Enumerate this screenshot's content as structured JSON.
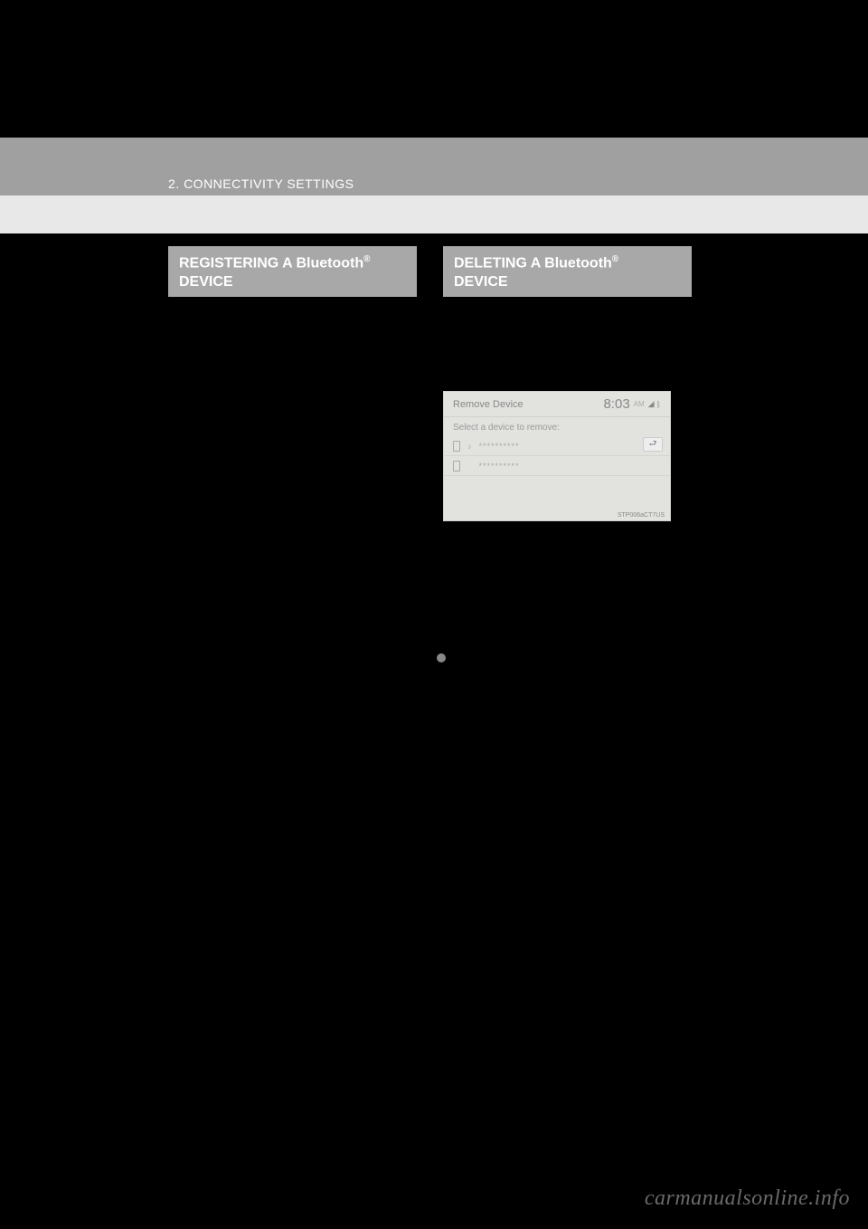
{
  "header": {
    "section": "2. CONNECTIVITY SETTINGS"
  },
  "left_section": {
    "title_prefix": "REGISTERING A Bluetooth",
    "title_suffix": "DEVICE"
  },
  "right_section": {
    "title_prefix": "DELETING A Bluetooth",
    "title_suffix": "DEVICE"
  },
  "screenshot": {
    "title": "Remove Device",
    "time": "8:03",
    "ampm": "AM",
    "subtitle": "Select a device to remove:",
    "device1": "**********",
    "device2": "**********",
    "label": "STP006aCT7US",
    "back": "⮐"
  },
  "watermark": "carmanualsonline.info"
}
